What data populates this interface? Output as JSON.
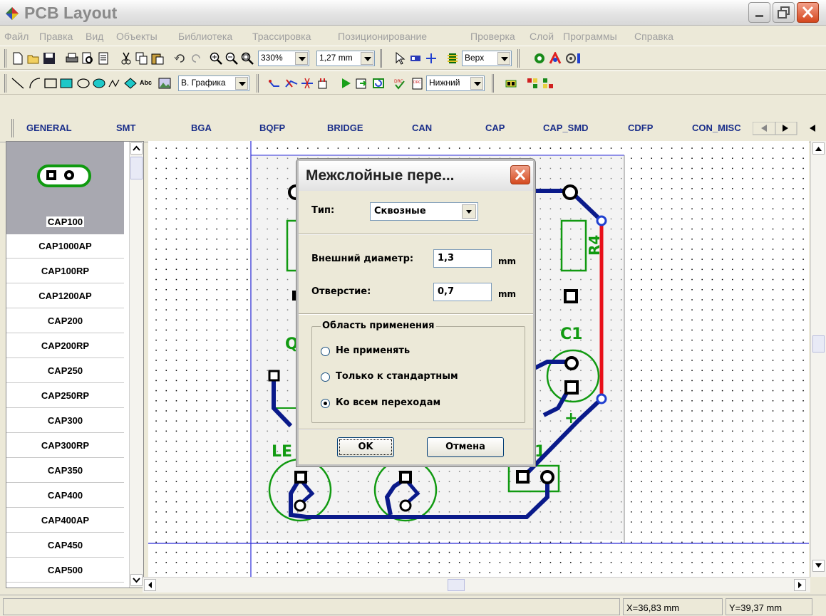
{
  "window": {
    "title": "PCB Layout"
  },
  "menu": [
    "Файл",
    "Правка",
    "Вид",
    "Объекты",
    "Библиотека",
    "Трассировка",
    "Позиционирование",
    "Проверка",
    "Слой",
    "Программы",
    "Справка"
  ],
  "toolbar1": {
    "zoom": "330%",
    "grid": "1,27 mm",
    "layer_top": "Верх"
  },
  "toolbar2": {
    "graphics_mode": "В. Графика",
    "layer_bottom": "Нижний",
    "text_tool": "Abc"
  },
  "library_tabs": [
    "GENERAL",
    "SMT",
    "BGA",
    "BQFP",
    "BRIDGE",
    "CAN",
    "CAP",
    "CAP_SMD",
    "CDFP",
    "CON_MISC"
  ],
  "library_items": [
    "CAP100",
    "CAP1000AP",
    "CAP100RP",
    "CAP1200AP",
    "CAP200",
    "CAP200RP",
    "CAP250",
    "CAP250RP",
    "CAP300",
    "CAP300RP",
    "CAP350",
    "CAP400",
    "CAP400AP",
    "CAP450",
    "CAP500"
  ],
  "selected_item": "CAP100",
  "board_labels": {
    "r4": "R4",
    "c1": "C1",
    "q": "Q",
    "le": "LE",
    "one": "1",
    "plus": "+"
  },
  "dialog": {
    "title": "Межслойные пере...",
    "type_label": "Тип:",
    "type_value": "Сквозные",
    "outer_diameter_label": "Внешний диаметр:",
    "outer_diameter_value": "1,3",
    "outer_unit": "mm",
    "hole_label": "Отверстие:",
    "hole_value": "0,7",
    "hole_unit": "mm",
    "scope_title": "Область применения",
    "options": [
      "Не применять",
      "Только к стандартным",
      "Ко всем переходам"
    ],
    "selected_option": 2,
    "ok": "OK",
    "cancel": "Отмена"
  },
  "status": {
    "x": "X=36,83 mm",
    "y": "Y=39,37 mm"
  },
  "colors": {
    "trace": "#0a1a8a",
    "silk": "#119a11",
    "red_trace": "#e8101a",
    "board_edge": "#2b2bd8"
  }
}
